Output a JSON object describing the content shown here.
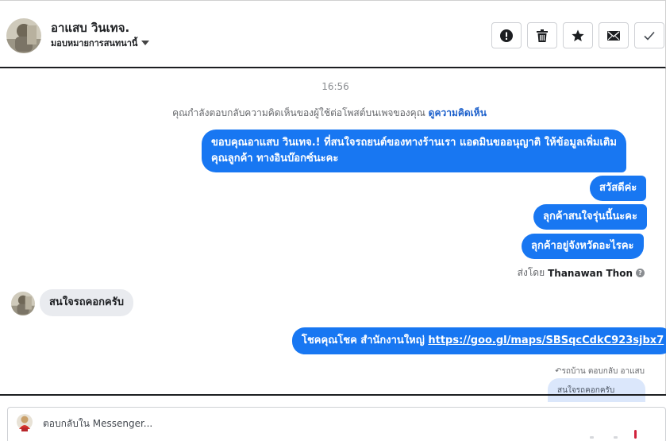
{
  "header": {
    "contact_name": "อาแสบ วินเทจ.",
    "assign_label": "มอบหมายการสนทนานี้",
    "actions": [
      {
        "name": "spam",
        "icon": "exclamation-circle-icon"
      },
      {
        "name": "delete",
        "icon": "trash-icon"
      },
      {
        "name": "follow-up",
        "icon": "star-icon"
      },
      {
        "name": "mark-unread",
        "icon": "envelope-icon"
      },
      {
        "name": "done",
        "icon": "checkmark-icon"
      }
    ]
  },
  "conversation": {
    "timestamp": "16:56",
    "notice_text": "คุณกำลังตอบกลับความคิดเห็นของผู้ใช้ต่อโพสต์บนเพจของคุณ",
    "notice_link": "ดูความคิดเห็น",
    "outgoing": [
      {
        "line1": "ขอบคุณอาแสบ วินเทจ.! ที่สนใจรถยนต์ของทางร้านเรา แอดมินขออนุญาติ ให้ข้อมูลเพิ่มเติม",
        "line2": "คุณลูกค้า ทางอินบ๊อกซ์นะคะ"
      },
      {
        "text": "สวัสดีค่ะ"
      },
      {
        "text": "ลุกค้าสนใจรุ่นนี้นะคะ"
      },
      {
        "text": "ลุกค้าอยู่จังหวัดอะไรคะ"
      }
    ],
    "sent_by_prefix": "ส่งโดย",
    "sent_by_name": "Thanawan Thon",
    "incoming": {
      "text": "สนใจรถคอกครับ"
    },
    "link_message": {
      "text": "โชคคุณโชค สำนักงานใหญ่",
      "url": "https://goo.gl/maps/SBSqcCdkC923sjbx7"
    },
    "reply_label": "รถบ้าน ตอบกลับ อาแสบ",
    "quoted_text": "สนใจรถคอกครับ"
  },
  "composer": {
    "placeholder": "ตอบกลับใน Messenger..."
  },
  "colors": {
    "accent": "#1877f2",
    "incoming_bubble": "#e9ebef",
    "link": "#1b5fcb"
  }
}
